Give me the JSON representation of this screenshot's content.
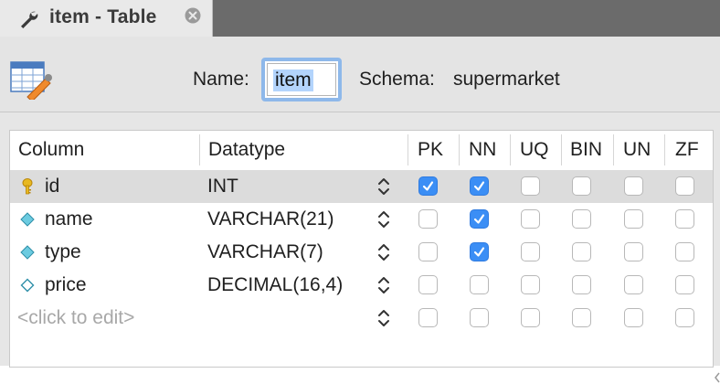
{
  "tab": {
    "title": "item - Table",
    "wrench_icon": "wrench-icon",
    "close_icon": "close-circle-icon"
  },
  "header": {
    "name_label": "Name:",
    "name_value": "item",
    "schema_label": "Schema:",
    "schema_value": "supermarket",
    "table_icon": "table-edit-icon"
  },
  "grid": {
    "columns": [
      "Column",
      "Datatype",
      "PK",
      "NN",
      "UQ",
      "BIN",
      "UN",
      "ZF"
    ],
    "rows": [
      {
        "name": "id",
        "datatype": "INT",
        "icon": "primary-key-icon",
        "flags": [
          true,
          true,
          false,
          false,
          false,
          false
        ],
        "selected": true
      },
      {
        "name": "name",
        "datatype": "VARCHAR(21)",
        "icon": "column-filled-diamond-icon",
        "flags": [
          false,
          true,
          false,
          false,
          false,
          false
        ],
        "selected": false
      },
      {
        "name": "type",
        "datatype": "VARCHAR(7)",
        "icon": "column-filled-diamond-icon",
        "flags": [
          false,
          true,
          false,
          false,
          false,
          false
        ],
        "selected": false
      },
      {
        "name": "price",
        "datatype": "DECIMAL(16,4)",
        "icon": "column-hollow-diamond-icon",
        "flags": [
          false,
          false,
          false,
          false,
          false,
          false
        ],
        "selected": false
      }
    ],
    "new_row_placeholder": "<click to edit>"
  },
  "colors": {
    "accent": "#3b8ef5",
    "selected_row": "#dcdcdc",
    "focus_ring": "#8eb8ea",
    "tab_strip": "#6b6b6b"
  }
}
